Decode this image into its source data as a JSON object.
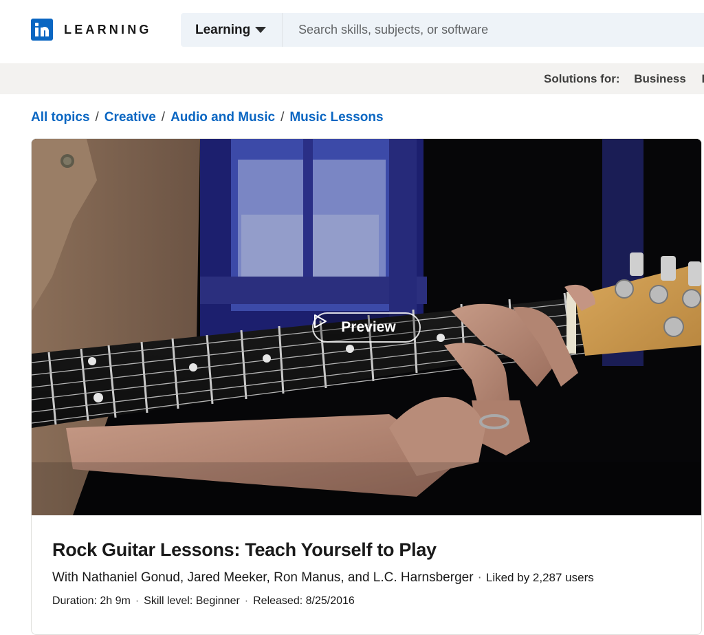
{
  "header": {
    "logo_text": "LEARNING",
    "scope_label": "Learning",
    "search_placeholder": "Search skills, subjects, or software"
  },
  "subbar": {
    "solutions_label": "Solutions for:",
    "link_business": "Business",
    "link_partial": "H"
  },
  "breadcrumb": {
    "items": [
      "All topics",
      "Creative",
      "Audio and Music",
      "Music Lessons"
    ],
    "separator": "/"
  },
  "video": {
    "preview_label": "Preview"
  },
  "course": {
    "title": "Rock Guitar Lessons: Teach Yourself to Play",
    "authors": "With Nathaniel Gonud, Jared Meeker, Ron Manus, and L.C. Harnsberger",
    "likes": "Liked by 2,287 users",
    "duration": "Duration: 2h 9m",
    "skill_level": "Skill level: Beginner",
    "released": "Released: 8/25/2016",
    "separator": "·"
  },
  "colors": {
    "brand": "#0a66c2",
    "link": "#0a66c2",
    "search_bg": "#eef3f8",
    "subbar_bg": "#f3f2f0"
  }
}
